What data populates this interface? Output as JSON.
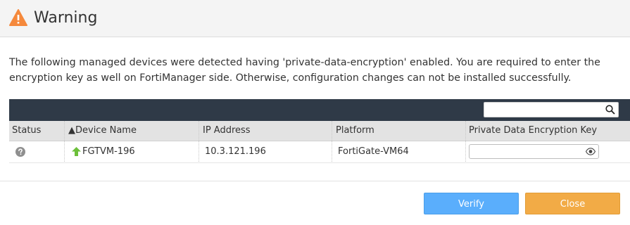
{
  "dialog": {
    "title": "Warning",
    "message": "The following managed devices were detected having 'private-data-encryption' enabled. You are required to enter the encryption key as well on FortiManager side. Otherwise, configuration changes can not be installed successfully."
  },
  "table": {
    "search_placeholder": "",
    "columns": {
      "status": "Status",
      "device_name": "▲Device Name",
      "ip_address": "IP Address",
      "platform": "Platform",
      "key": "Private Data Encryption Key"
    },
    "rows": [
      {
        "status_icon": "question-circle-icon",
        "device_icon": "up-arrow-icon",
        "device_name": "FGTVM-196",
        "ip_address": "10.3.121.196",
        "platform": "FortiGate-VM64",
        "key_value": ""
      }
    ]
  },
  "buttons": {
    "verify": "Verify",
    "close": "Close"
  },
  "colors": {
    "warning": "#f5893c",
    "toolbar": "#2f3a47",
    "verify": "#5aaefc",
    "close": "#f2ab46",
    "online": "#6cbf3a"
  }
}
